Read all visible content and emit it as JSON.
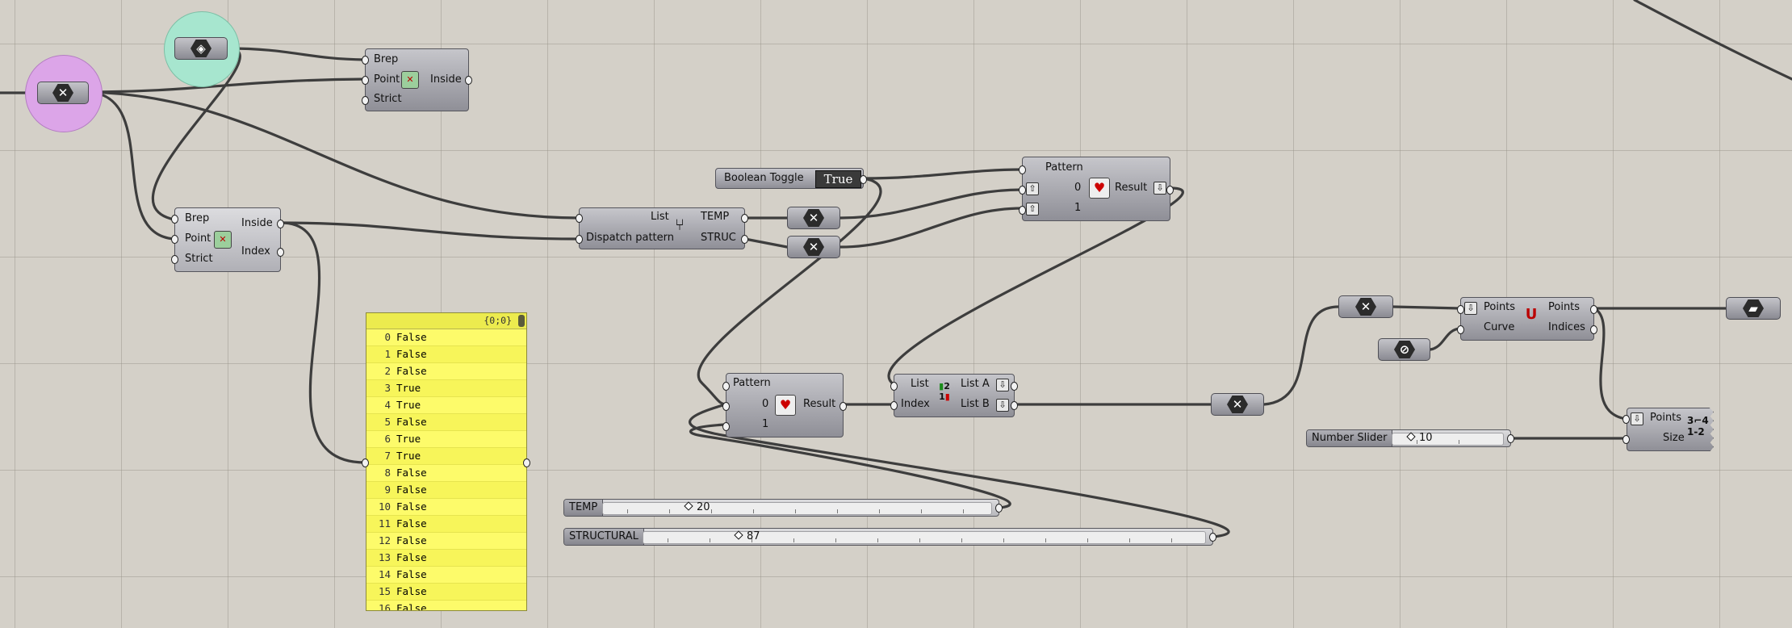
{
  "canvas": {
    "background": "#d4d0c8",
    "wire_color": "#3d3d3d",
    "panel_color": "#fdfb6a"
  },
  "inside_top": {
    "inputs": [
      "Brep",
      "Point",
      "Strict"
    ],
    "output": "Inside",
    "icon": "point-in-brep-icon"
  },
  "inside_left": {
    "inputs": [
      "Brep",
      "Point",
      "Strict"
    ],
    "outputs": [
      "Inside",
      "Index"
    ],
    "icon": "points-in-breps-icon"
  },
  "dispatch": {
    "inputs": [
      "List",
      "Dispatch pattern"
    ],
    "outputs": [
      "TEMP",
      "STRUC"
    ],
    "icon": "dispatch-icon"
  },
  "boolean_toggle": {
    "label": "Boolean Toggle",
    "value": "True"
  },
  "pattern_top": {
    "title": "Pattern",
    "inputs": [
      "0",
      "1"
    ],
    "output": "Result",
    "icon": "weave-icon"
  },
  "pattern_bottom": {
    "title": "Pattern",
    "inputs": [
      "0",
      "1"
    ],
    "output": "Result",
    "icon": "weave-icon"
  },
  "list_item": {
    "inputs": [
      "List",
      "Index"
    ],
    "outputs": [
      "List A",
      "List B"
    ],
    "icon": "split-list-icon"
  },
  "panel": {
    "path": "{0;0}",
    "rows": [
      {
        "i": "0",
        "v": "False"
      },
      {
        "i": "1",
        "v": "False"
      },
      {
        "i": "2",
        "v": "False"
      },
      {
        "i": "3",
        "v": "True"
      },
      {
        "i": "4",
        "v": "True"
      },
      {
        "i": "5",
        "v": "False"
      },
      {
        "i": "6",
        "v": "True"
      },
      {
        "i": "7",
        "v": "True"
      },
      {
        "i": "8",
        "v": "False"
      },
      {
        "i": "9",
        "v": "False"
      },
      {
        "i": "10",
        "v": "False"
      },
      {
        "i": "11",
        "v": "False"
      },
      {
        "i": "12",
        "v": "False"
      },
      {
        "i": "13",
        "v": "False"
      },
      {
        "i": "14",
        "v": "False"
      },
      {
        "i": "15",
        "v": "False"
      },
      {
        "i": "16",
        "v": "False"
      }
    ]
  },
  "slider_temp": {
    "label": "TEMP",
    "value": "20"
  },
  "slider_structural": {
    "label": "STRUCTURAL",
    "value": "87"
  },
  "slider_number": {
    "label": "Number Slider",
    "value": "10"
  },
  "cull_points": {
    "inputs": [
      "Points",
      "Curve"
    ],
    "outputs": [
      "Points",
      "Indices"
    ],
    "icon": "closest-points-icon"
  },
  "point_list": {
    "inputs": [
      "Points",
      "Size"
    ],
    "icon": "point-list-icon"
  }
}
